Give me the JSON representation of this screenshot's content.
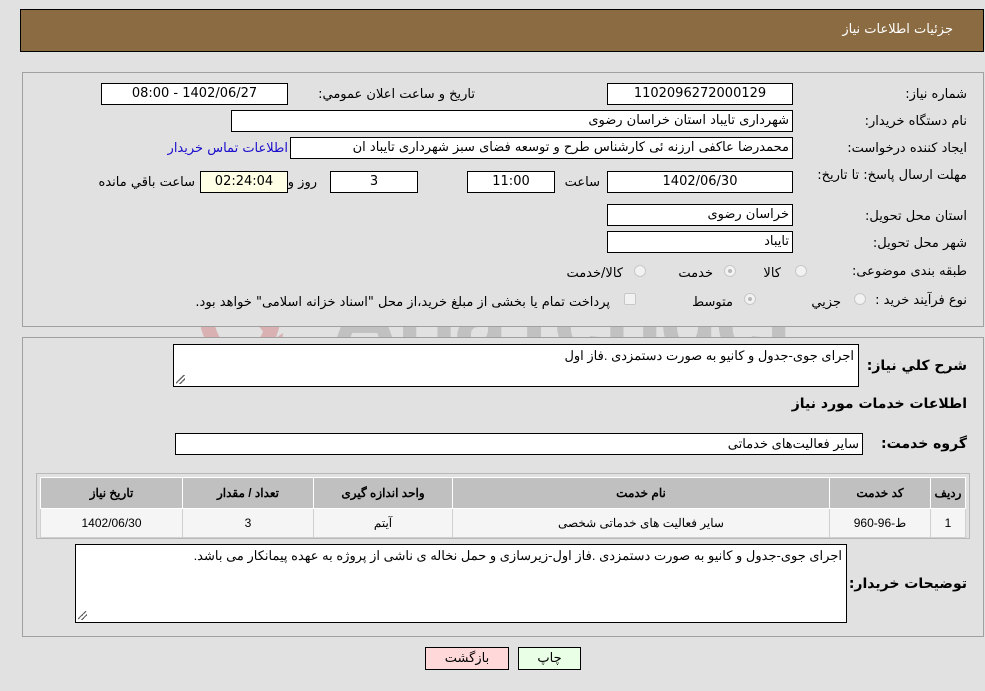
{
  "header": {
    "title": "جزئیات اطلاعات نیاز"
  },
  "form": {
    "need_number_label": "شماره نیاز:",
    "need_number": "1102096272000129",
    "announce_label": "تاریخ و ساعت اعلان عمومي:",
    "announce_value": "1402/06/27 - 08:00",
    "buyer_org_label": "نام دستگاه خریدار:",
    "buyer_org": "شهرداری تایباد استان خراسان رضوی",
    "creator_label": "ایجاد کننده درخواست:",
    "creator": "محمدرضا عاکفی ارزنه ئی کارشناس طرح و توسعه فضای سبز شهرداری تایباد ان",
    "contact_link": "اطلاعات تماس خریدار",
    "deadline_label": "مهلت ارسال پاسخ: تا تاریخ:",
    "deadline_date": "1402/06/30",
    "time_label": "ساعت",
    "deadline_time": "11:00",
    "days_value": "3",
    "days_label": "روز و",
    "remaining_time": "02:24:04",
    "remaining_label": "ساعت باقي مانده",
    "province_label": "استان محل تحویل:",
    "province": "خراسان رضوی",
    "city_label": "شهر محل تحویل:",
    "city": "تایباد",
    "category_label": "طبقه بندی موضوعی:",
    "category_options": [
      {
        "label": "کالا",
        "checked": false
      },
      {
        "label": "خدمت",
        "checked": true
      },
      {
        "label": "کالا/خدمت",
        "checked": false
      }
    ],
    "process_label": "نوع فرآیند خرید :",
    "process_options": [
      {
        "label": "جزيي",
        "checked": false
      },
      {
        "label": "متوسط",
        "checked": true
      }
    ],
    "treasury_note": "پرداخت تمام یا بخشی از مبلغ خرید،از محل \"اسناد خزانه اسلامی\" خواهد بود."
  },
  "details": {
    "summary_label": "شرح کلي نیاز:",
    "summary": "اجرای جوی-جدول و کانیو به صورت دستمزدی .فاز اول",
    "services_heading": "اطلاعات خدمات مورد نیاز",
    "service_group_label": "گروه خدمت:",
    "service_group": "سایر فعالیت‌های خدماتی",
    "table": {
      "headers": [
        "ردیف",
        "کد خدمت",
        "نام خدمت",
        "واحد اندازه گیری",
        "تعداد / مقدار",
        "تاریخ نیاز"
      ],
      "rows": [
        [
          "1",
          "ط-96-960",
          "سایر فعالیت های خدماتی شخصی",
          "آیتم",
          "3",
          "1402/06/30"
        ]
      ]
    },
    "buyer_notes_label": "توضیحات خریدار:",
    "buyer_notes": "اجرای جوی-جدول و کانیو به صورت دستمزدی .فاز اول-زیرسازی و حمل نخاله ی ناشی از پروژه به عهده پیمانکار می باشد."
  },
  "buttons": {
    "print": "چاپ",
    "back": "بازگشت"
  },
  "watermark": {
    "text": "AriaTender.neT",
    "color": "#c8696b"
  }
}
